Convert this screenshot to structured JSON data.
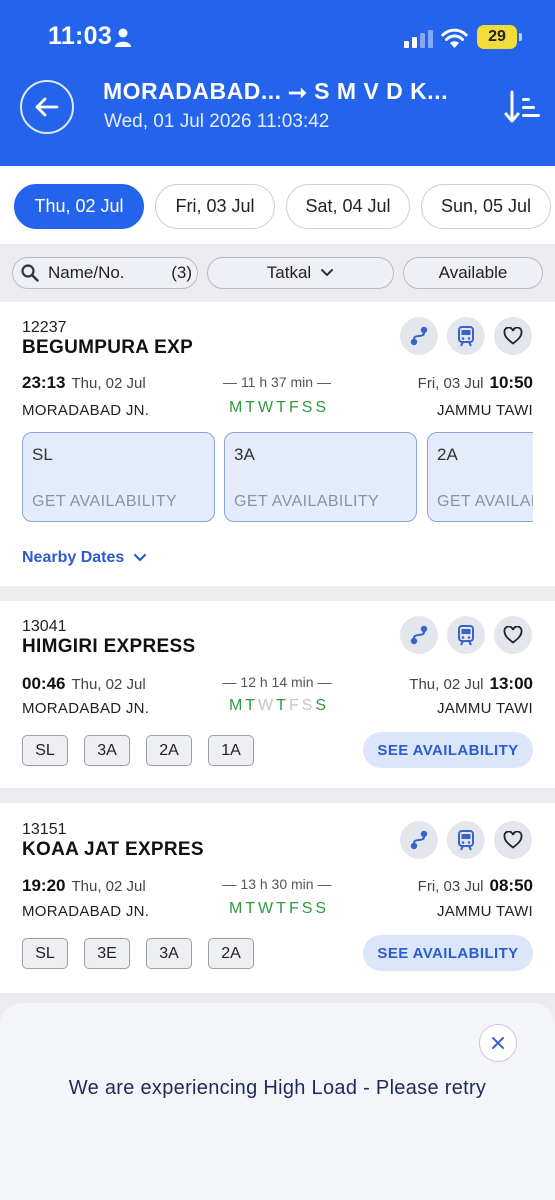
{
  "status": {
    "time": "11:03",
    "battery": "29"
  },
  "header": {
    "route": "MORADABAD... ⭢ S M V D K...",
    "datetime": "Wed, 01 Jul 2026 11:03:42"
  },
  "date_tabs": [
    {
      "label": "Thu, 02 Jul",
      "active": true
    },
    {
      "label": "Fri, 03 Jul",
      "active": false
    },
    {
      "label": "Sat, 04 Jul",
      "active": false
    },
    {
      "label": "Sun, 05 Jul",
      "active": false
    }
  ],
  "filters": {
    "search_label": "Name/No.",
    "search_count": "(3)",
    "quota": "Tatkal",
    "availability": "Available"
  },
  "trains": [
    {
      "number": "12237",
      "name": "BEGUMPURA EXP",
      "dep_time": "23:13",
      "dep_date": "Thu, 02 Jul",
      "duration": "11 h 37 min",
      "arr_date": "Fri, 03 Jul",
      "arr_time": "10:50",
      "from": "MORADABAD JN.",
      "to": "JAMMU TAWI",
      "days": [
        {
          "d": "M",
          "on": true
        },
        {
          "d": "T",
          "on": true
        },
        {
          "d": "W",
          "on": true
        },
        {
          "d": "T",
          "on": true
        },
        {
          "d": "F",
          "on": true
        },
        {
          "d": "S",
          "on": true
        },
        {
          "d": "S",
          "on": true
        }
      ],
      "classes": [
        {
          "cls": "SL",
          "action": "GET AVAILABILITY"
        },
        {
          "cls": "3A",
          "action": "GET AVAILABILITY"
        },
        {
          "cls": "2A",
          "action": "GET AVAILABILITY"
        }
      ],
      "nearby_label": "Nearby Dates"
    },
    {
      "number": "13041",
      "name": "HIMGIRI EXPRESS",
      "dep_time": "00:46",
      "dep_date": "Thu, 02 Jul",
      "duration": "12 h 14 min",
      "arr_date": "Thu, 02 Jul",
      "arr_time": "13:00",
      "from": "MORADABAD JN.",
      "to": "JAMMU TAWI",
      "days": [
        {
          "d": "M",
          "on": true
        },
        {
          "d": "T",
          "on": true
        },
        {
          "d": "W",
          "on": false
        },
        {
          "d": "T",
          "on": true
        },
        {
          "d": "F",
          "on": false
        },
        {
          "d": "S",
          "on": false
        },
        {
          "d": "S",
          "on": true
        }
      ],
      "chips": [
        "SL",
        "3A",
        "2A",
        "1A"
      ],
      "see_label": "SEE AVAILABILITY"
    },
    {
      "number": "13151",
      "name": "KOAA JAT EXPRES",
      "dep_time": "19:20",
      "dep_date": "Thu, 02 Jul",
      "duration": "13 h 30 min",
      "arr_date": "Fri, 03 Jul",
      "arr_time": "08:50",
      "from": "MORADABAD JN.",
      "to": "JAMMU TAWI",
      "days": [
        {
          "d": "M",
          "on": true
        },
        {
          "d": "T",
          "on": true
        },
        {
          "d": "W",
          "on": true
        },
        {
          "d": "T",
          "on": true
        },
        {
          "d": "F",
          "on": true
        },
        {
          "d": "S",
          "on": true
        },
        {
          "d": "S",
          "on": true
        }
      ],
      "chips": [
        "SL",
        "3E",
        "3A",
        "2A"
      ],
      "see_label": "SEE AVAILABILITY"
    }
  ],
  "toast": {
    "message": "We are experiencing High Load - Please retry"
  },
  "colors": {
    "primary": "#2463eb",
    "run_day": "#2e9b3e",
    "off_day": "#c6c6c6",
    "link": "#2d5ccc"
  }
}
